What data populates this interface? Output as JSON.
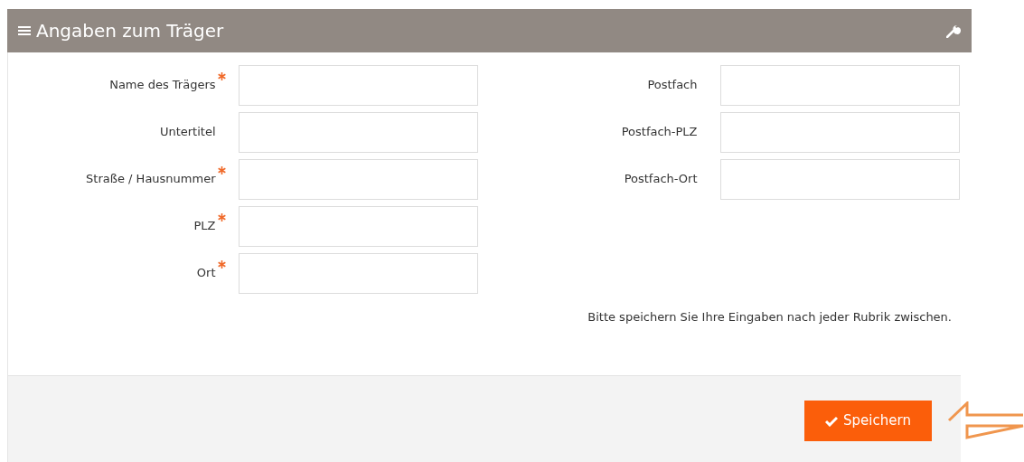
{
  "panel": {
    "title": "Angaben zum Träger"
  },
  "left_fields": [
    {
      "label": "Name des Trägers",
      "required": true
    },
    {
      "label": "Untertitel",
      "required": false
    },
    {
      "label": "Straße / Hausnummer",
      "required": true
    },
    {
      "label": "PLZ",
      "required": true
    },
    {
      "label": "Ort",
      "required": true
    }
  ],
  "right_fields": [
    {
      "label": "Postfach",
      "required": false
    },
    {
      "label": "Postfach-PLZ",
      "required": false
    },
    {
      "label": "Postfach-Ort",
      "required": false
    }
  ],
  "note": "Bitte speichern Sie Ihre Eingaben nach jeder Rubrik zwischen.",
  "save_button": {
    "label": "Speichern"
  }
}
